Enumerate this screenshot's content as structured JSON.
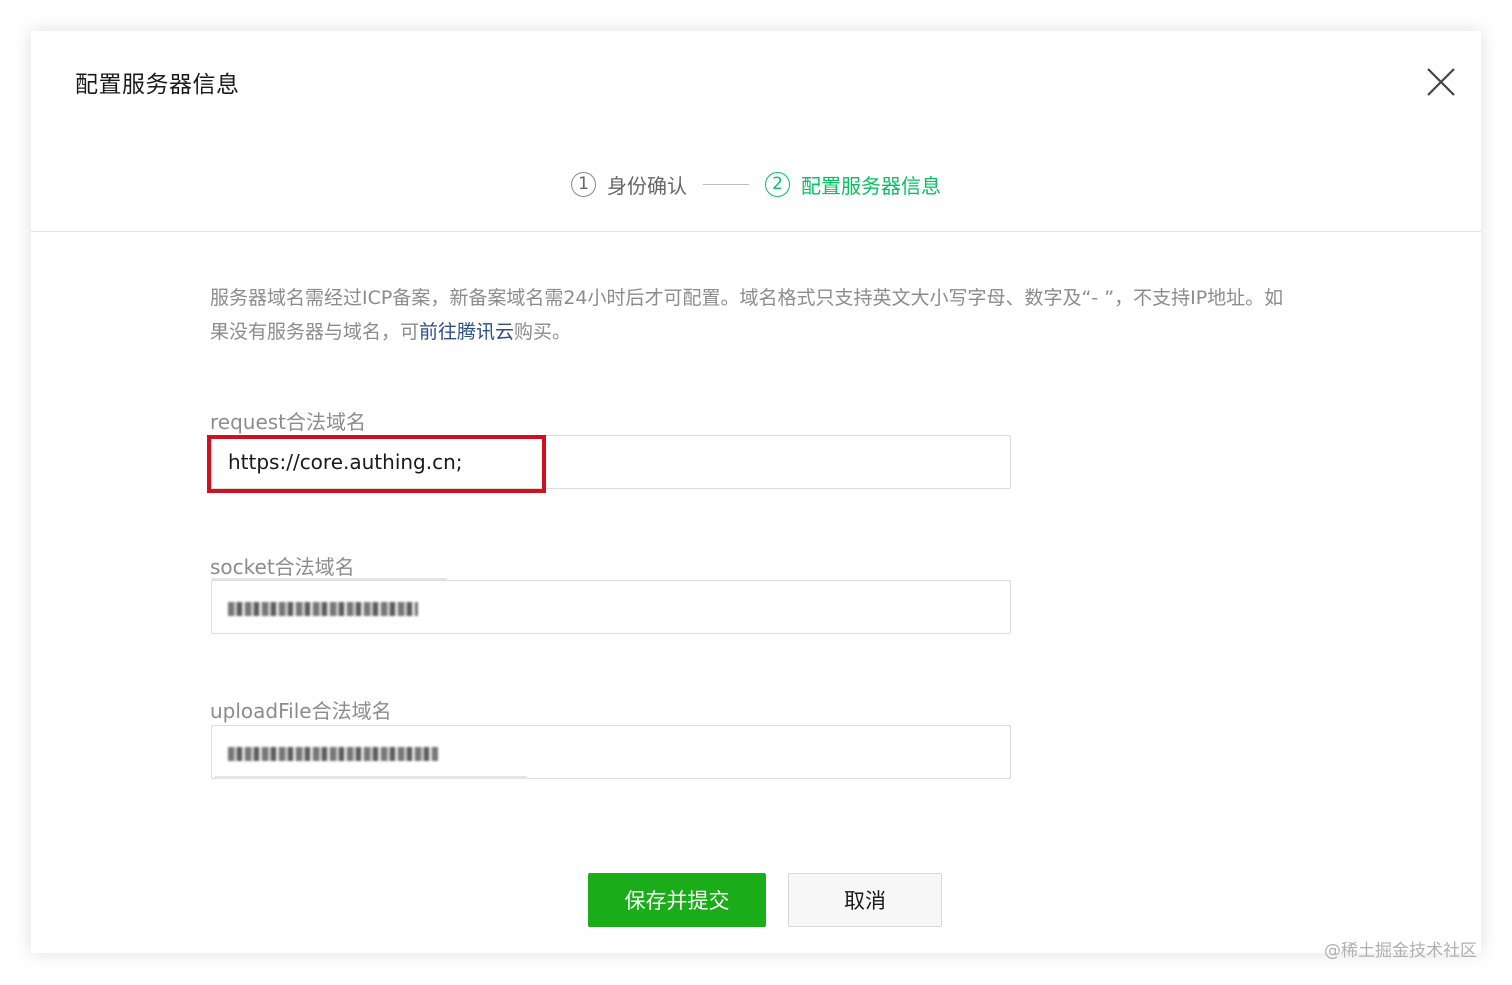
{
  "dialog": {
    "title": "配置服务器信息",
    "close_icon": "close-icon"
  },
  "steps": [
    {
      "number": "1",
      "label": "身份确认",
      "active": false
    },
    {
      "number": "2",
      "label": "配置服务器信息",
      "active": true
    }
  ],
  "notice": {
    "text_before_link": "服务器域名需经过ICP备案，新备案域名需24小时后才可配置。域名格式只支持英文大小写字母、数字及“- ”，不支持IP地址。如果没有服务器与域名，可",
    "link_text": "前往腾讯云",
    "text_after_link": "购买。"
  },
  "fields": [
    {
      "label": "request合法域名",
      "value": "https://core.authing.cn;"
    },
    {
      "label": "socket合法域名",
      "value": ""
    },
    {
      "label": "uploadFile合法域名",
      "value": ""
    }
  ],
  "buttons": {
    "save_label": "保存并提交",
    "cancel_label": "取消"
  },
  "watermark": "@稀土掘金技术社区",
  "colors": {
    "accent_green": "#07c160",
    "button_green": "#1aad19",
    "highlight_red": "#d01020",
    "link_blue": "#2c4e8a"
  }
}
